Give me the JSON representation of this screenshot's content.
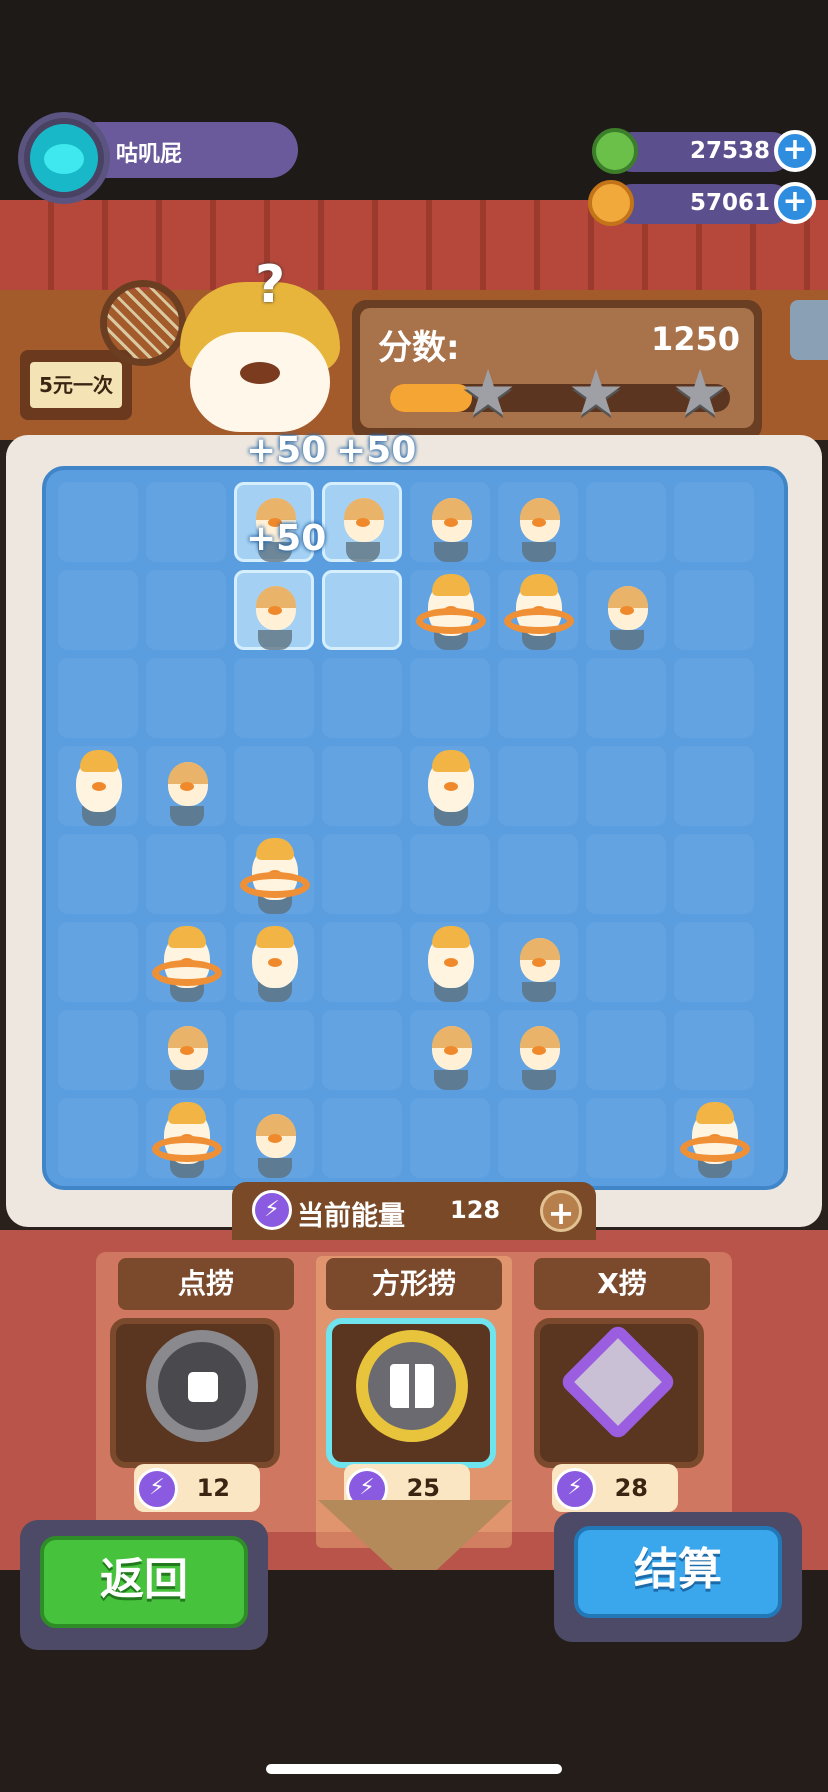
{
  "player": {
    "name": "咕叽屁"
  },
  "currencies": [
    {
      "name": "green-gem",
      "value": "27538",
      "color": "#6bc04a"
    },
    {
      "name": "gold-coin",
      "value": "57061",
      "color": "#f2a93b"
    }
  ],
  "sign": {
    "text": "5元一次"
  },
  "score": {
    "label": "分数:",
    "value": "1250",
    "progress": 0.24,
    "stars_earned": 0,
    "stars_total": 3
  },
  "board": {
    "cols": 8,
    "rows": 8,
    "selected_cells": [
      [
        2,
        0
      ],
      [
        3,
        0
      ],
      [
        2,
        1
      ],
      [
        3,
        1
      ]
    ],
    "popups": [
      "+50",
      "+50",
      "+50"
    ],
    "ducks": [
      {
        "c": 2,
        "r": 0,
        "kind": "small"
      },
      {
        "c": 3,
        "r": 0,
        "kind": "small"
      },
      {
        "c": 4,
        "r": 0,
        "kind": "small"
      },
      {
        "c": 5,
        "r": 0,
        "kind": "small"
      },
      {
        "c": 2,
        "r": 1,
        "kind": "small"
      },
      {
        "c": 4,
        "r": 1,
        "kind": "ring"
      },
      {
        "c": 5,
        "r": 1,
        "kind": "ring"
      },
      {
        "c": 6,
        "r": 1,
        "kind": "small"
      },
      {
        "c": 0,
        "r": 3,
        "kind": "big"
      },
      {
        "c": 1,
        "r": 3,
        "kind": "small"
      },
      {
        "c": 4,
        "r": 3,
        "kind": "big"
      },
      {
        "c": 2,
        "r": 4,
        "kind": "ring"
      },
      {
        "c": 1,
        "r": 5,
        "kind": "ring"
      },
      {
        "c": 2,
        "r": 5,
        "kind": "big"
      },
      {
        "c": 4,
        "r": 5,
        "kind": "big"
      },
      {
        "c": 5,
        "r": 5,
        "kind": "small"
      },
      {
        "c": 1,
        "r": 6,
        "kind": "small"
      },
      {
        "c": 4,
        "r": 6,
        "kind": "small"
      },
      {
        "c": 5,
        "r": 6,
        "kind": "small"
      },
      {
        "c": 1,
        "r": 7,
        "kind": "ring"
      },
      {
        "c": 2,
        "r": 7,
        "kind": "small"
      },
      {
        "c": 7,
        "r": 7,
        "kind": "ring"
      }
    ]
  },
  "energy": {
    "label": "当前能量",
    "value": "128",
    "plus": "+"
  },
  "tools": [
    {
      "name": "点捞",
      "cost": "12",
      "icon": "single-net-icon",
      "selected": false
    },
    {
      "name": "方形捞",
      "cost": "25",
      "icon": "square-net-icon",
      "selected": true
    },
    {
      "name": "X捞",
      "cost": "28",
      "icon": "x-net-icon",
      "selected": false
    }
  ],
  "buttons": {
    "back": "返回",
    "settle": "结算"
  },
  "icons": {
    "plus": "+",
    "star": "★",
    "question": "?",
    "energy": "⚡"
  }
}
